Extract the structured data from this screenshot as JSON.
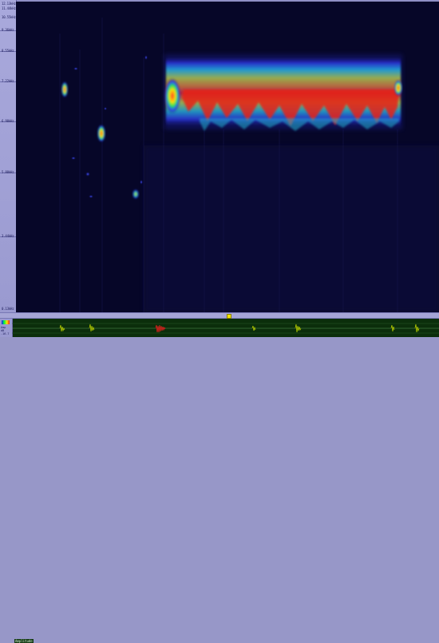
{
  "ruler": {
    "ticks": [
      "12.13kHz",
      "11.44kHz",
      "10.55kHz",
      "9.36kHz",
      "8.55kHz",
      "7.22kHz",
      "6.90kHz",
      "5.80kHz",
      "3.44kHz",
      "0.13kHz"
    ]
  },
  "waveform": {
    "label": "Amplitude",
    "side_labels": [
      "Amp",
      "dB",
      "-16.7"
    ]
  },
  "colors": {
    "background": "#050525",
    "ruler": "#a9a9dc",
    "wave_bg": "#0b2e0b",
    "wave_signal": "#c8e000",
    "wave_peak": "#ff2020",
    "scroll_thumb": "#f2e200"
  }
}
